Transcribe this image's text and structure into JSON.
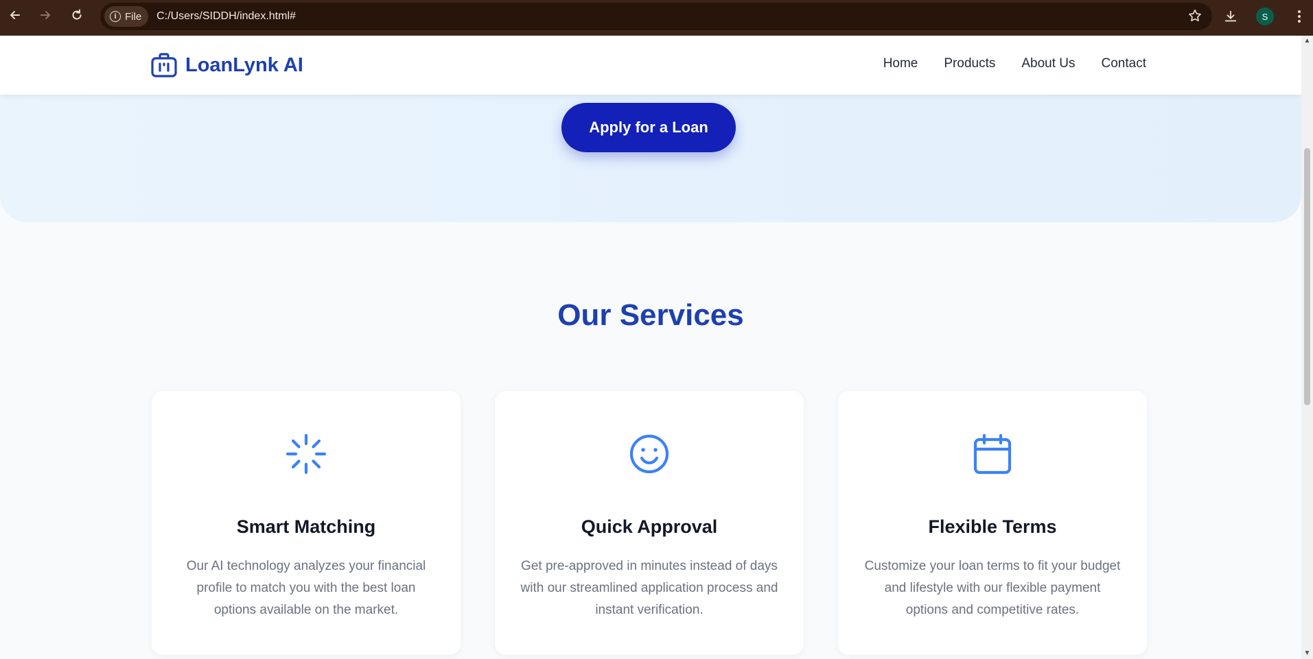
{
  "browser": {
    "back_icon": "arrow-left-icon",
    "forward_icon": "arrow-right-icon",
    "reload_icon": "reload-icon",
    "file_label": "File",
    "url": "C:/Users/SIDDH/index.html#",
    "avatar_letter": "S"
  },
  "header": {
    "brand": "LoanLynk AI",
    "nav": [
      "Home",
      "Products",
      "About Us",
      "Contact"
    ]
  },
  "hero": {
    "cta_label": "Apply for a Loan"
  },
  "services": {
    "title": "Our Services",
    "items": [
      {
        "icon": "loader-icon",
        "title": "Smart Matching",
        "description": "Our AI technology analyzes your financial profile to match you with the best loan options available on the market."
      },
      {
        "icon": "smile-icon",
        "title": "Quick Approval",
        "description": "Get pre-approved in minutes instead of days with our streamlined application process and instant verification."
      },
      {
        "icon": "calendar-icon",
        "title": "Flexible Terms",
        "description": "Customize your loan terms to fit your budget and lifestyle with our flexible payment options and competitive rates."
      }
    ]
  },
  "colors": {
    "brand": "#1e40af",
    "accent": "#3b82f6",
    "cta": "#1321b8"
  }
}
